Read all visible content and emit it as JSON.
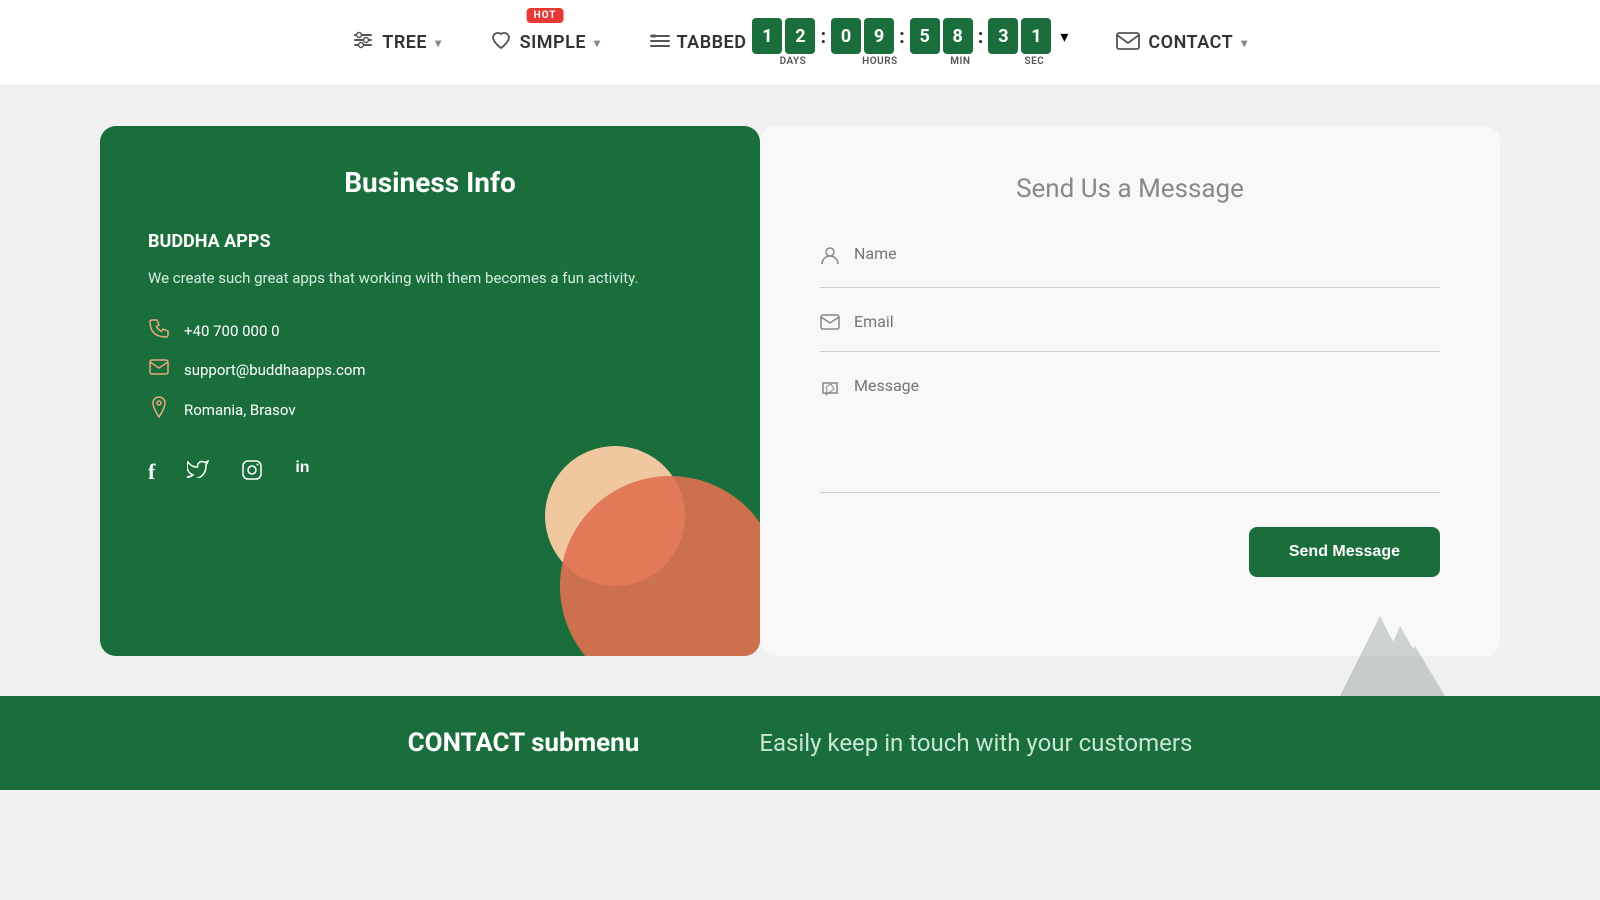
{
  "navbar": {
    "tree_label": "TREE",
    "simple_label": "SIMPLE",
    "hot_badge": "HOT",
    "tabbed_label": "TABBED",
    "contact_label": "CONTACT",
    "countdown": {
      "days": [
        "1",
        "2"
      ],
      "hours": [
        "0",
        "9"
      ],
      "minutes": [
        "5",
        "8"
      ],
      "seconds": [
        "3",
        "1"
      ],
      "days_label": "DAYS",
      "hours_label": "HOURS",
      "min_label": "MIN",
      "sec_label": "SEC"
    }
  },
  "business_info": {
    "title": "Business Info",
    "company_name": "BUDDHA APPS",
    "description": "We create such great apps that working with them becomes a fun activity.",
    "phone": "+40 700 000 0",
    "email": "support@buddhaapps.com",
    "location": "Romania, Brasov"
  },
  "contact_form": {
    "title": "Send Us a Message",
    "name_placeholder": "Name",
    "email_placeholder": "Email",
    "message_placeholder": "Message",
    "send_button": "Send Message"
  },
  "footer": {
    "title": "CONTACT submenu",
    "subtitle": "Easily keep in touch with your customers"
  },
  "icons": {
    "tree": "⊟",
    "heart": "♡",
    "list": "≡",
    "mail": "✉",
    "phone": "📞",
    "email_icon": "✉",
    "location_icon": "📍",
    "facebook": "f",
    "twitter": "t",
    "instagram": "◉",
    "linkedin": "in",
    "person": "👤",
    "edit": "✏"
  }
}
